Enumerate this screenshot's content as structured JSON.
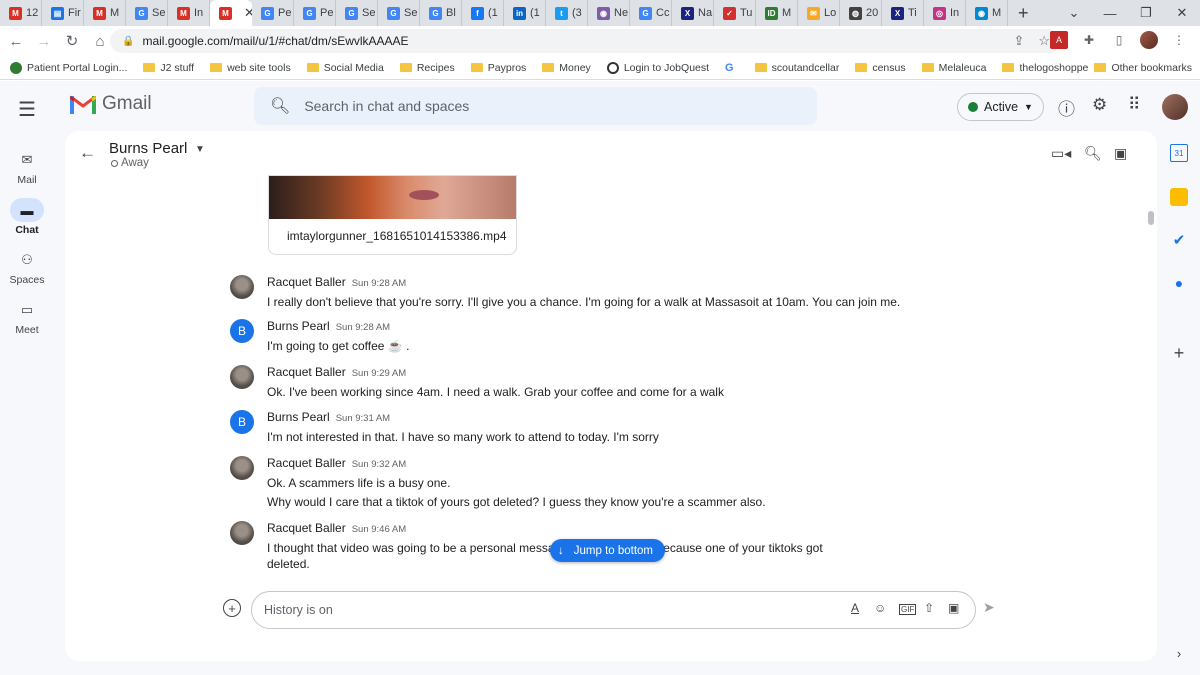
{
  "browser": {
    "tabs": [
      {
        "label": "12",
        "fav": "gmail-icon",
        "color": "#d93025"
      },
      {
        "label": "Fir",
        "fav": "sheet-icon",
        "color": "#1a73e8"
      },
      {
        "label": "M",
        "fav": "gmail-icon",
        "color": "#d93025"
      },
      {
        "label": "Se",
        "fav": "google-icon",
        "color": "#4285f4"
      },
      {
        "label": "In",
        "fav": "gmail-icon",
        "color": "#d93025"
      },
      {
        "label": "",
        "fav": "gmail-icon",
        "color": "#d93025",
        "active": true
      },
      {
        "label": "Pe",
        "fav": "google-icon",
        "color": "#4285f4"
      },
      {
        "label": "Pe",
        "fav": "google-icon",
        "color": "#4285f4"
      },
      {
        "label": "Se",
        "fav": "google-icon",
        "color": "#4285f4"
      },
      {
        "label": "Se",
        "fav": "google-icon",
        "color": "#4285f4"
      },
      {
        "label": "Bl",
        "fav": "google-icon",
        "color": "#4285f4"
      },
      {
        "label": "(1",
        "fav": "facebook-icon",
        "color": "#1877f2"
      },
      {
        "label": "(1",
        "fav": "linkedin-icon",
        "color": "#0a66c2"
      },
      {
        "label": "(3",
        "fav": "twitter-icon",
        "color": "#1d9bf0"
      },
      {
        "label": "Ne",
        "fav": "app-icon",
        "color": "#7b5ea7"
      },
      {
        "label": "Cc",
        "fav": "google-icon",
        "color": "#4285f4"
      },
      {
        "label": "Na",
        "fav": "x-icon",
        "color": "#1a237e"
      },
      {
        "label": "Tu",
        "fav": "check-icon",
        "color": "#d32f2f"
      },
      {
        "label": "M",
        "fav": "id-icon",
        "color": "#2e7d32"
      },
      {
        "label": "Lo",
        "fav": "mail-icon",
        "color": "#f9a825"
      },
      {
        "label": "20",
        "fav": "globe-icon",
        "color": "#424242"
      },
      {
        "label": "Ti",
        "fav": "x-icon",
        "color": "#1a237e"
      },
      {
        "label": "In",
        "fav": "instagram-icon",
        "color": "#c13584"
      },
      {
        "label": "M",
        "fav": "app-icon",
        "color": "#0288d1"
      }
    ],
    "url": "mail.google.com/mail/u/1/#chat/dm/sEwvlkAAAAE",
    "bookmarks": [
      "Patient Portal Login...",
      "J2 stuff",
      "web site tools",
      "Social Media",
      "Recipes",
      "Paypros",
      "Money",
      "Login to JobQuest",
      "",
      "scoutandcellar",
      "census",
      "Melaleuca",
      "thelogoshoppe"
    ],
    "other_bookmarks": "Other bookmarks"
  },
  "gmail": {
    "app_name": "Gmail",
    "search_placeholder": "Search in chat and spaces",
    "status": "Active",
    "rail": [
      {
        "label": "Mail",
        "icon": "mail-icon"
      },
      {
        "label": "Chat",
        "icon": "chat-icon",
        "selected": true
      },
      {
        "label": "Spaces",
        "icon": "spaces-icon"
      },
      {
        "label": "Meet",
        "icon": "video-icon"
      }
    ]
  },
  "chat": {
    "contact": "Burns Pearl",
    "presence": "Away",
    "attachment": "imtaylorgunner_1681651014153386.mp4",
    "messages": [
      {
        "sender": "Racquet Baller",
        "time": "Sun 9:28 AM",
        "avatar": "photo",
        "lines": [
          "I really don't believe that you're sorry. I'll give you a chance. I'm going for a walk at Massasoit at 10am.  You can join me."
        ]
      },
      {
        "sender": "Burns Pearl",
        "time": "Sun 9:28 AM",
        "avatar": "B",
        "lines": [
          "I'm going to get coffee ☕ ."
        ]
      },
      {
        "sender": "Racquet Baller",
        "time": "Sun 9:29 AM",
        "avatar": "photo",
        "lines": [
          "Ok. I've been working since 4am. I need a walk. Grab your coffee and come for a walk"
        ]
      },
      {
        "sender": "Burns Pearl",
        "time": "Sun 9:31 AM",
        "avatar": "B",
        "lines": [
          "I'm not interested in that.  I have so many work to attend to today.  I'm sorry"
        ]
      },
      {
        "sender": "Racquet Baller",
        "time": "Sun 9:32 AM",
        "avatar": "photo",
        "lines": [
          "Ok. A scammers life is a busy one.",
          "Why would I care that a tiktok of yours got deleted? I guess they know you're a scammer also."
        ]
      },
      {
        "sender": "Racquet Baller",
        "time": "Sun 9:46 AM",
        "avatar": "photo",
        "lines": [
          "I thought that video was going to be a personal message to                                   for sympathy because one of your tiktoks got",
          "deleted."
        ]
      }
    ],
    "jump_label": "Jump to bottom",
    "composer_placeholder": "History is on"
  }
}
